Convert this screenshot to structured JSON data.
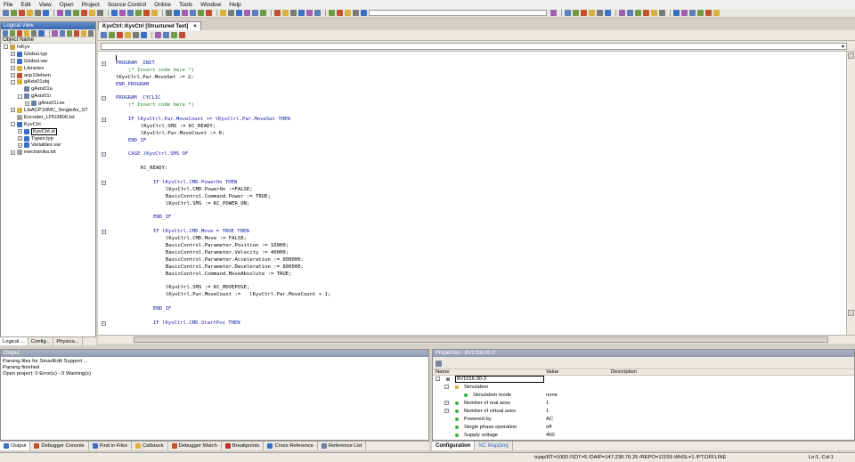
{
  "menu": [
    "File",
    "Edit",
    "View",
    "Open",
    "Project",
    "Source Control",
    "Online",
    "Tools",
    "Window",
    "Help"
  ],
  "logical_view": {
    "title": "Logical View",
    "column_header": "Object Name",
    "tree": [
      {
        "label": "InKyv",
        "indent": 0,
        "exp": "-",
        "color": "#c8a040"
      },
      {
        "label": "Global.typ",
        "indent": 1,
        "exp": "+",
        "color": "#3b6fc4"
      },
      {
        "label": "Global.var",
        "indent": 1,
        "exp": "+",
        "color": "#3b6fc4"
      },
      {
        "label": "Libraries",
        "indent": 1,
        "exp": "+",
        "color": "#d8b040"
      },
      {
        "label": "acp10etxen",
        "indent": 1,
        "exp": "+",
        "color": "#c05030"
      },
      {
        "label": "gAxis01obj",
        "indent": 1,
        "exp": "-",
        "color": "#d8b040"
      },
      {
        "label": "gAxis01a",
        "indent": 2,
        "exp": "",
        "color": "#7080a0"
      },
      {
        "label": "gAxis01i",
        "indent": 2,
        "exp": "-",
        "color": "#7080a0"
      },
      {
        "label": "gAxis01i.ax",
        "indent": 3,
        "exp": "+",
        "color": "#7080a0"
      },
      {
        "label": "LibACP10MC_SingleAx_ST",
        "indent": 1,
        "exp": "+",
        "color": "#d8b040"
      },
      {
        "label": "Encoder_LPD3806.txt",
        "indent": 1,
        "exp": "",
        "color": "#a0a0a0"
      },
      {
        "label": "KyvCtrl",
        "indent": 1,
        "exp": "-",
        "color": "#3b6fc4"
      },
      {
        "label": "KyvCtrl.st",
        "indent": 2,
        "exp": "+",
        "color": "#3b6fc4",
        "selected": true
      },
      {
        "label": "Types.typ",
        "indent": 2,
        "exp": "+",
        "color": "#3b6fc4"
      },
      {
        "label": "Variables.var",
        "indent": 2,
        "exp": "+",
        "color": "#3b6fc4"
      },
      {
        "label": "mechanika.txt",
        "indent": 1,
        "exp": "+",
        "color": "#a0a0a0"
      }
    ],
    "tabs": [
      "Logical ...",
      "Config...",
      "Physica..."
    ]
  },
  "editor": {
    "tab_label": "KyvCtrl::KyvCtrl [Structured Text]",
    "tab_close": "×",
    "lines": [
      {
        "t": "",
        "i": 0
      },
      {
        "t": "PROGRAM _INIT",
        "i": 0,
        "k": true,
        "fold": "-"
      },
      {
        "t": "(* Insert code here *)",
        "i": 1,
        "c": true
      },
      {
        "t": "lKyvCtrl.Par.MoveSet := 2;",
        "i": 0
      },
      {
        "t": "END_PROGRAM",
        "i": 0,
        "k": true
      },
      {
        "t": "",
        "i": 0
      },
      {
        "t": "PROGRAM _CYCLIC",
        "i": 0,
        "k": true,
        "fold": "-"
      },
      {
        "t": "(* Insert code here *)",
        "i": 1,
        "c": true
      },
      {
        "t": "",
        "i": 0
      },
      {
        "t": "IF lKyvCtrl.Par.MoveCount >= lKyvCtrl.Par.MoveSet THEN",
        "i": 1,
        "k": true,
        "fold": "-"
      },
      {
        "t": "lKyvCtrl.SMS := KC_READY;",
        "i": 2
      },
      {
        "t": "lKyvCtrl.Par.MoveCount := 0;",
        "i": 2
      },
      {
        "t": "END_IF",
        "i": 1,
        "k": true
      },
      {
        "t": "",
        "i": 0
      },
      {
        "t": "CASE lKyvCtrl.SMS OF",
        "i": 1,
        "k": true,
        "fold": "-"
      },
      {
        "t": "",
        "i": 0
      },
      {
        "t": "KC_READY:",
        "i": 2
      },
      {
        "t": "",
        "i": 0
      },
      {
        "t": "IF lKyvCtrl.CMD.PowerOn THEN",
        "i": 3,
        "k": true,
        "fold": "-"
      },
      {
        "t": "lKyvCtrl.CMD.PowerOn :=FALSE;",
        "i": 4
      },
      {
        "t": "BasicControl.Command.Power := TRUE;",
        "i": 4
      },
      {
        "t": "lKyvCtrl.SMS := KC_POWER_ON;",
        "i": 4
      },
      {
        "t": "",
        "i": 0
      },
      {
        "t": "END_IF",
        "i": 3,
        "k": true
      },
      {
        "t": "",
        "i": 0
      },
      {
        "t": "IF lKyvCtrl.CMD.Move = TRUE THEN",
        "i": 3,
        "k": true,
        "fold": "-"
      },
      {
        "t": "lKyvCtrl.CMD.Move := FALSE;",
        "i": 4
      },
      {
        "t": "BasicControl.Parameter.Position := 16000;",
        "i": 4
      },
      {
        "t": "BasicControl.Parameter.Velocity := 40000;",
        "i": 4
      },
      {
        "t": "BasicControl.Parameter.Acceleration := 800000;",
        "i": 4
      },
      {
        "t": "BasicControl.Parameter.Deceleration := 800000;",
        "i": 4
      },
      {
        "t": "BasicControl.Command.MoveAbsolute := TRUE;",
        "i": 4
      },
      {
        "t": "",
        "i": 0
      },
      {
        "t": "lKyvCtrl.SMS := KC_MOVEPOSE;",
        "i": 4
      },
      {
        "t": "lKyvCtrl.Par.MoveCount :=   lKyvCtrl.Par.MoveCount + 1;",
        "i": 4
      },
      {
        "t": "",
        "i": 0
      },
      {
        "t": "END_IF",
        "i": 3,
        "k": true
      },
      {
        "t": "",
        "i": 0
      },
      {
        "t": "IF lKyvCtrl.CMD.StartPos THEN",
        "i": 3,
        "k": true,
        "fold": "-"
      }
    ]
  },
  "output": {
    "title": "Output",
    "lines": [
      "Parsing files for SmartEdit Support ...",
      "Parsing finished",
      "Open project: 0 Error(s) - 0 Warning(s)"
    ],
    "tabs": [
      {
        "label": "Output",
        "color": "#3b6fc4",
        "active": true
      },
      {
        "label": "Debugger Console",
        "color": "#c05030"
      },
      {
        "label": "Find in Files",
        "color": "#3b6fc4"
      },
      {
        "label": "Callstack",
        "color": "#d8b040"
      },
      {
        "label": "Debugger Watch",
        "color": "#c05030"
      },
      {
        "label": "Breakpoints",
        "color": "#c03030"
      },
      {
        "label": "Cross Reference",
        "color": "#3b6fc4"
      },
      {
        "label": "Reference List",
        "color": "#7080a0"
      }
    ]
  },
  "properties": {
    "title": "Properties - 8V1016.00-2",
    "headers": {
      "name": "Name",
      "value": "Value",
      "description": "Description"
    },
    "rows": [
      {
        "name": "8V1016.00-2",
        "value": "",
        "indent": 0,
        "exp": "-",
        "boxed": true
      },
      {
        "name": "Simulation",
        "value": "",
        "indent": 1,
        "exp": "-"
      },
      {
        "name": "Simulation mode",
        "value": "none",
        "indent": 2,
        "exp": ""
      },
      {
        "name": "Number of real axes",
        "value": "1",
        "indent": 1,
        "exp": "+"
      },
      {
        "name": "Number of virtual axes",
        "value": "1",
        "indent": 1,
        "exp": "+"
      },
      {
        "name": "Powered by",
        "value": "AC",
        "indent": 1,
        "exp": ""
      },
      {
        "name": "Single phase operation",
        "value": "off",
        "indent": 1,
        "exp": ""
      },
      {
        "name": "Supply voltage",
        "value": "400",
        "indent": 1,
        "exp": ""
      }
    ],
    "tabs": [
      {
        "label": "Configuration",
        "active": true
      },
      {
        "label": "NC Mapping",
        "active": false
      }
    ]
  },
  "status": {
    "connection": "tcpip/RT=1000 /SDT=5 /DAIP=147.230.76.25 /REPO=11159 /ANSL=1 /PT...",
    "mode": "OFFLINE",
    "position": "Ln:1, Col:1"
  }
}
